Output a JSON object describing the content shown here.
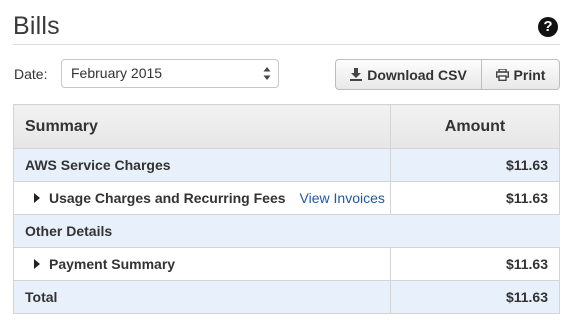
{
  "page": {
    "title": "Bills"
  },
  "header": {
    "help_icon": "question-circle-icon"
  },
  "filters": {
    "date_label": "Date:",
    "date_value": "February 2015"
  },
  "actions": {
    "download_csv_label": "Download CSV",
    "download_icon": "download-icon",
    "print_label": "Print",
    "print_icon": "printer-icon"
  },
  "table": {
    "headers": {
      "summary": "Summary",
      "amount": "Amount"
    },
    "rows": [
      {
        "label": "AWS Service Charges",
        "amount": "$11.63"
      },
      {
        "label": "Usage Charges and Recurring Fees",
        "link": "View Invoices",
        "amount": "$11.63"
      },
      {
        "label": "Other Details",
        "amount": ""
      },
      {
        "label": "Payment Summary",
        "amount": "$11.63"
      },
      {
        "label": "Total",
        "amount": "$11.63"
      }
    ]
  }
}
